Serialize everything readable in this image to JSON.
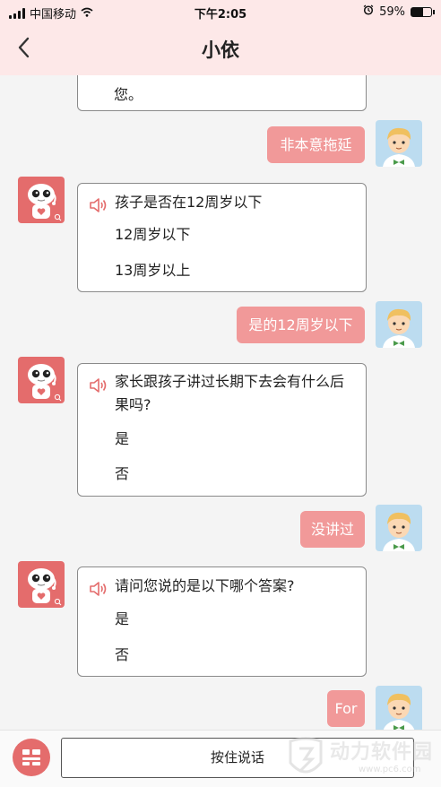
{
  "status_bar": {
    "carrier": "中国移动",
    "time": "下午2:05",
    "battery": "59%",
    "battery_level": 0.59
  },
  "header": {
    "title": "小依"
  },
  "chat": {
    "partial_top_text": "您。",
    "messages": [
      {
        "type": "user",
        "text": "非本意拖延"
      },
      {
        "type": "bot",
        "question": "孩子是否在12周岁以下",
        "options": [
          "12周岁以下",
          "13周岁以上"
        ]
      },
      {
        "type": "user",
        "text": "是的12周岁以下"
      },
      {
        "type": "bot",
        "question": "家长跟孩子讲过长期下去会有什么后果吗?",
        "options": [
          "是",
          "否"
        ]
      },
      {
        "type": "user",
        "text": "没讲过"
      },
      {
        "type": "bot",
        "question": "请问您说的是以下哪个答案?",
        "options": [
          "是",
          "否"
        ]
      },
      {
        "type": "user",
        "text": "For"
      }
    ]
  },
  "input": {
    "voice_label": "按住说话"
  },
  "watermark": {
    "text": "动力软件园",
    "url": "www.pc6.com"
  },
  "colors": {
    "header_bg": "#fde8e8",
    "user_bubble": "#f19999",
    "accent": "#e46c6c"
  }
}
